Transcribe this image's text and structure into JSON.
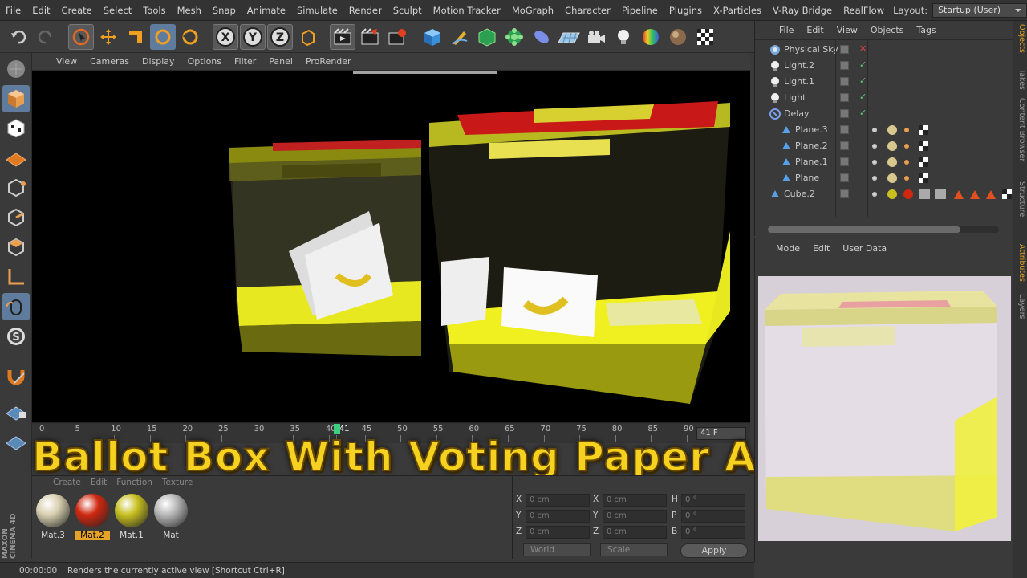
{
  "menubar": {
    "items": [
      "File",
      "Edit",
      "Create",
      "Select",
      "Tools",
      "Mesh",
      "Snap",
      "Animate",
      "Simulate",
      "Render",
      "Sculpt",
      "Motion Tracker",
      "MoGraph",
      "Character",
      "Pipeline",
      "Plugins",
      "X-Particles",
      "V-Ray Bridge",
      "RealFlow"
    ],
    "layout_label": "Layout:",
    "layout_value": "Startup (User)"
  },
  "toolbar": {
    "icons": [
      "undo-icon",
      "redo-icon",
      "live-selection-icon",
      "move-icon",
      "scale-icon",
      "rotate-icon",
      "recent-tool-icon",
      "x-axis-icon",
      "y-axis-icon",
      "z-axis-icon",
      "coordinate-system-icon",
      "render-view-icon",
      "render-picture-viewer-icon",
      "render-settings-icon",
      "cube-icon",
      "pen-icon",
      "subdivision-icon",
      "mograph-cloner-icon",
      "deformer-icon",
      "floor-icon",
      "camera-icon",
      "light-icon",
      "environment-icon",
      "checker-icon"
    ]
  },
  "left_tools": {
    "icons": [
      "make-editable-icon",
      "model-mode-icon",
      "texture-mode-icon",
      "workplane-icon",
      "points-mode-icon",
      "edges-mode-icon",
      "polygons-mode-icon",
      "axis-mode-icon",
      "tweak-icon",
      "snap-icon",
      "magnet-icon",
      "locked-workplane-icon",
      "planar-workplane-icon"
    ]
  },
  "viewport": {
    "menu": [
      "View",
      "Cameras",
      "Display",
      "Options",
      "Filter",
      "Panel",
      "ProRender"
    ]
  },
  "timeline": {
    "ticks": [
      "0",
      "5",
      "10",
      "15",
      "20",
      "25",
      "30",
      "35",
      "40",
      "41",
      "45",
      "50",
      "55",
      "60",
      "65",
      "70",
      "75",
      "80",
      "85",
      "90"
    ],
    "current_frame": "41 F",
    "current_index": 41
  },
  "materials": {
    "menu": [
      "Create",
      "Edit",
      "Function",
      "Texture"
    ],
    "items": [
      {
        "label": "Mat.3",
        "color": "#d8d0b0",
        "selected": false
      },
      {
        "label": "Mat.2",
        "color": "#d02810",
        "selected": true
      },
      {
        "label": "Mat.1",
        "color": "#c8c020",
        "selected": false
      },
      {
        "label": "Mat",
        "color": "#b8b8b8",
        "selected": false
      }
    ]
  },
  "coords": {
    "pos_labels": [
      "X",
      "Y",
      "Z"
    ],
    "size_labels": [
      "X",
      "Y",
      "Z"
    ],
    "rot_labels": [
      "H",
      "P",
      "B"
    ],
    "pos_values": [
      "0 cm",
      "0 cm",
      "0 cm"
    ],
    "size_values": [
      "0 cm",
      "0 cm",
      "0 cm"
    ],
    "rot_values": [
      "0 °",
      "0 °",
      "0 °"
    ],
    "world": "World",
    "scale": "Scale",
    "apply": "Apply"
  },
  "status": {
    "time": "00:00:00",
    "message": "Renders the currently active view [Shortcut Ctrl+R]"
  },
  "objects": {
    "menu": [
      "File",
      "Edit",
      "View",
      "Objects",
      "Tags"
    ],
    "rows": [
      {
        "name": "Physical Sky",
        "indent": 0,
        "icon": "sky-icon",
        "check": "x"
      },
      {
        "name": "Light.2",
        "indent": 0,
        "icon": "light-icon",
        "check": "v"
      },
      {
        "name": "Light.1",
        "indent": 0,
        "icon": "light-icon",
        "check": "v"
      },
      {
        "name": "Light",
        "indent": 0,
        "icon": "light-icon",
        "check": "v"
      },
      {
        "name": "Delay",
        "indent": 0,
        "icon": "effector-icon",
        "check": "v"
      },
      {
        "name": "Plane.3",
        "indent": 1,
        "icon": "plane-icon",
        "check": ""
      },
      {
        "name": "Plane.2",
        "indent": 1,
        "icon": "plane-icon",
        "check": ""
      },
      {
        "name": "Plane.1",
        "indent": 1,
        "icon": "plane-icon",
        "check": ""
      },
      {
        "name": "Plane",
        "indent": 1,
        "icon": "plane-icon",
        "check": ""
      },
      {
        "name": "Cube.2",
        "indent": 0,
        "icon": "cube-icon",
        "check": ""
      }
    ]
  },
  "attributes": {
    "menu": [
      "Mode",
      "Edit",
      "User Data"
    ]
  },
  "right_tabs": [
    "Objects",
    "Takes",
    "Content Browser",
    "Structure",
    "Attributes",
    "Layers"
  ],
  "overlay_title": "Ballot Box With Voting Paper Animation",
  "branding": "MAXON CINEMA 4D"
}
